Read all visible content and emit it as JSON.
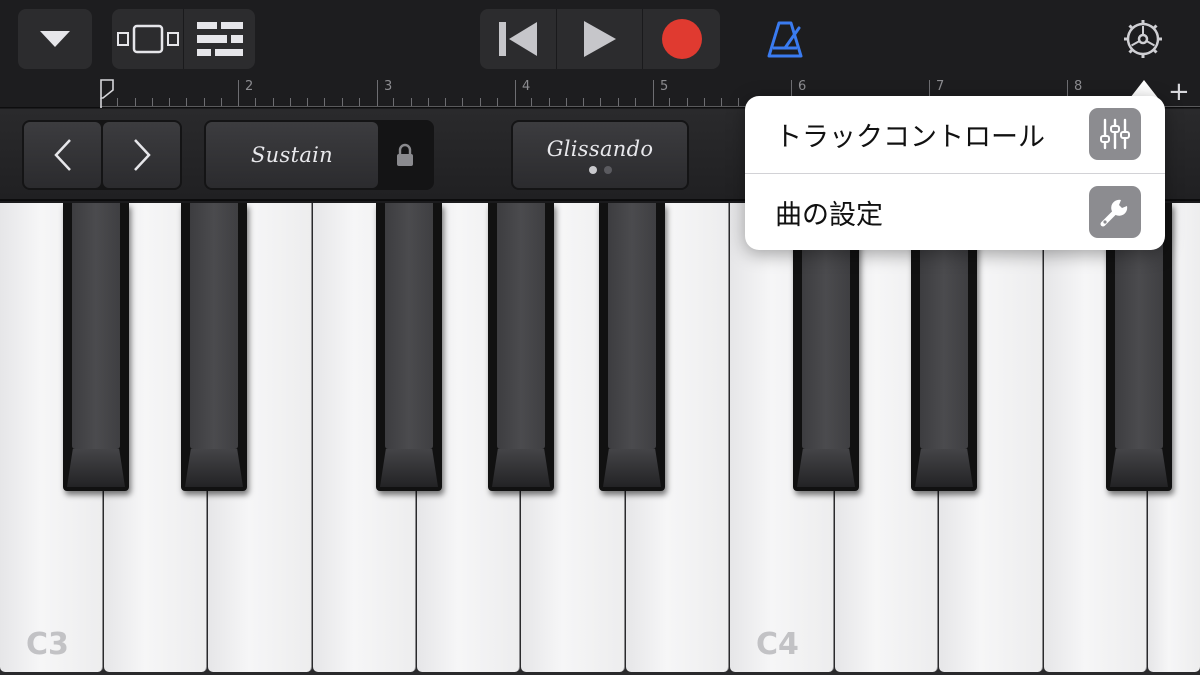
{
  "toolbar": {
    "icons": [
      "browser-menu-icon",
      "tracks-view-icon",
      "mixer-view-icon",
      "rewind-icon",
      "play-icon",
      "record-icon",
      "metronome-icon",
      "settings-gear-icon"
    ],
    "colors": {
      "record": "#e03a30",
      "metronome": "#3a7bf0",
      "icon": "#d8d8dc"
    }
  },
  "ruler": {
    "bars": [
      "2",
      "3",
      "4",
      "5",
      "6",
      "7",
      "8"
    ],
    "add_label": "+"
  },
  "controls": {
    "prev_label": "‹",
    "next_label": "›",
    "sustain_label": "Sustain",
    "glissando_label": "Glissando"
  },
  "keyboard": {
    "octave_labels": [
      "C3",
      "C4"
    ]
  },
  "popover": {
    "items": [
      {
        "label": "トラックコントロール",
        "icon": "sliders-icon"
      },
      {
        "label": "曲の設定",
        "icon": "wrench-icon"
      }
    ]
  }
}
